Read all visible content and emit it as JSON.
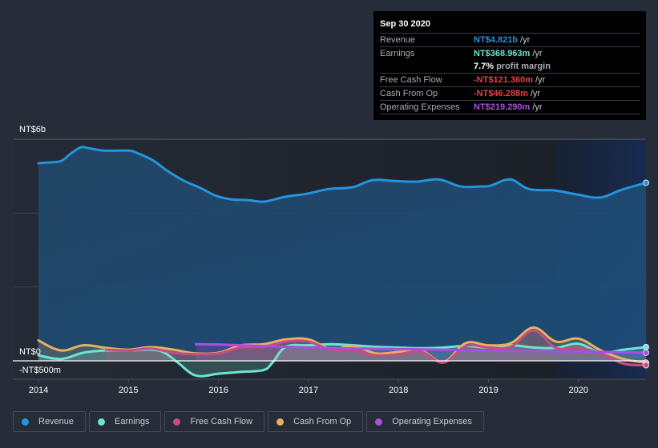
{
  "tooltip": {
    "date": "Sep 30 2020",
    "rows": [
      {
        "label": "Revenue",
        "value": "NT$4.821b",
        "unit": "/yr",
        "color": "#2394df"
      },
      {
        "label": "Earnings",
        "value": "NT$368.963m",
        "unit": "/yr",
        "color": "#6ce5d0"
      },
      {
        "label": "",
        "value": "7.7%",
        "unit": "profit margin",
        "color": "#ffffff"
      },
      {
        "label": "Free Cash Flow",
        "value": "-NT$121.360m",
        "unit": "/yr",
        "color": "#e64141"
      },
      {
        "label": "Cash From Op",
        "value": "-NT$46.288m",
        "unit": "/yr",
        "color": "#e64141"
      },
      {
        "label": "Operating Expenses",
        "value": "NT$219.290m",
        "unit": "/yr",
        "color": "#a94ee5"
      }
    ]
  },
  "legend": [
    {
      "label": "Revenue",
      "color": "#2394df"
    },
    {
      "label": "Earnings",
      "color": "#6ce5d0"
    },
    {
      "label": "Free Cash Flow",
      "color": "#c84b87"
    },
    {
      "label": "Cash From Op",
      "color": "#e9b15e"
    },
    {
      "label": "Operating Expenses",
      "color": "#a94ee5"
    }
  ],
  "chart_data": {
    "type": "area",
    "title": "",
    "xlabel": "",
    "ylabel": "",
    "y_unit": "NT$ billions",
    "ylim": [
      -0.5,
      6
    ],
    "xlim": [
      2013.7,
      2020.75
    ],
    "y_tick_labels": [
      {
        "value": 6,
        "label": "NT$6b"
      },
      {
        "value": 0,
        "label": "NT$0"
      },
      {
        "value": -0.5,
        "label": "-NT$500m"
      }
    ],
    "y_gridlines": [
      6,
      4,
      2,
      0
    ],
    "x_ticks": [
      2014,
      2015,
      2016,
      2017,
      2018,
      2019,
      2020
    ],
    "x_tick_labels": [
      "2014",
      "2015",
      "2016",
      "2017",
      "2018",
      "2019",
      "2020"
    ],
    "highlight_from": 2019.75,
    "legend_position": "bottom-left",
    "series": [
      {
        "name": "Revenue",
        "color": "#2394df",
        "x": [
          2014.0,
          2014.11,
          2014.25,
          2014.36,
          2014.47,
          2014.55,
          2014.73,
          2015.0,
          2015.11,
          2015.27,
          2015.44,
          2015.62,
          2015.8,
          2015.98,
          2016.15,
          2016.33,
          2016.51,
          2016.74,
          2017.0,
          2017.22,
          2017.49,
          2017.71,
          2017.94,
          2018.2,
          2018.45,
          2018.69,
          2018.91,
          2019.02,
          2019.24,
          2019.45,
          2019.74,
          2019.99,
          2020.24,
          2020.48,
          2020.75
        ],
        "values": [
          5.35,
          5.37,
          5.41,
          5.61,
          5.78,
          5.76,
          5.69,
          5.69,
          5.61,
          5.43,
          5.13,
          4.87,
          4.68,
          4.46,
          4.37,
          4.35,
          4.31,
          4.44,
          4.53,
          4.65,
          4.7,
          4.89,
          4.87,
          4.85,
          4.91,
          4.72,
          4.72,
          4.74,
          4.91,
          4.65,
          4.61,
          4.5,
          4.42,
          4.63,
          4.82
        ]
      },
      {
        "name": "Earnings",
        "color": "#6ce5d0",
        "x": [
          2014.0,
          2014.25,
          2014.5,
          2014.75,
          2015.0,
          2015.25,
          2015.4,
          2015.55,
          2015.75,
          2016.0,
          2016.25,
          2016.5,
          2016.6,
          2016.75,
          2017.0,
          2017.25,
          2017.5,
          2017.75,
          2018.0,
          2018.25,
          2018.5,
          2018.75,
          2019.0,
          2019.25,
          2019.5,
          2019.75,
          2020.0,
          2020.25,
          2020.5,
          2020.75
        ],
        "values": [
          0.15,
          0.05,
          0.22,
          0.28,
          0.28,
          0.3,
          0.22,
          -0.05,
          -0.4,
          -0.35,
          -0.3,
          -0.25,
          -0.05,
          0.38,
          0.42,
          0.45,
          0.42,
          0.38,
          0.36,
          0.34,
          0.36,
          0.4,
          0.36,
          0.42,
          0.36,
          0.35,
          0.46,
          0.22,
          0.3,
          0.37
        ]
      },
      {
        "name": "Free Cash Flow",
        "color": "#c84b87",
        "x": [
          2014.75,
          2015.0,
          2015.25,
          2015.5,
          2015.75,
          2016.0,
          2016.25,
          2016.5,
          2016.75,
          2017.0,
          2017.25,
          2017.5,
          2017.75,
          2018.0,
          2018.25,
          2018.5,
          2018.75,
          2019.0,
          2019.25,
          2019.5,
          2019.75,
          2020.0,
          2020.25,
          2020.5,
          2020.75
        ],
        "values": [
          0.3,
          0.28,
          0.33,
          0.22,
          0.18,
          0.2,
          0.36,
          0.38,
          0.52,
          0.52,
          0.3,
          0.28,
          0.15,
          0.18,
          0.25,
          -0.05,
          0.4,
          0.36,
          0.38,
          0.82,
          0.35,
          0.35,
          0.2,
          -0.08,
          -0.12
        ]
      },
      {
        "name": "Cash From Op",
        "color": "#e9b15e",
        "x": [
          2014.0,
          2014.25,
          2014.5,
          2014.75,
          2015.0,
          2015.25,
          2015.5,
          2015.75,
          2016.0,
          2016.25,
          2016.5,
          2016.75,
          2017.0,
          2017.25,
          2017.5,
          2017.75,
          2018.0,
          2018.25,
          2018.5,
          2018.75,
          2019.0,
          2019.25,
          2019.5,
          2019.75,
          2020.0,
          2020.25,
          2020.5,
          2020.75
        ],
        "values": [
          0.55,
          0.28,
          0.42,
          0.35,
          0.3,
          0.37,
          0.3,
          0.2,
          0.22,
          0.42,
          0.45,
          0.58,
          0.58,
          0.32,
          0.4,
          0.2,
          0.24,
          0.28,
          -0.03,
          0.48,
          0.42,
          0.48,
          0.9,
          0.52,
          0.6,
          0.28,
          0.05,
          -0.05
        ]
      },
      {
        "name": "Operating Expenses",
        "color": "#a94ee5",
        "x": [
          2015.75,
          2016.0,
          2016.5,
          2017.0,
          2017.5,
          2018.0,
          2018.5,
          2019.0,
          2019.5,
          2020.0,
          2020.5,
          2020.75
        ],
        "values": [
          0.45,
          0.44,
          0.4,
          0.36,
          0.33,
          0.32,
          0.3,
          0.27,
          0.26,
          0.25,
          0.23,
          0.22
        ]
      }
    ]
  }
}
